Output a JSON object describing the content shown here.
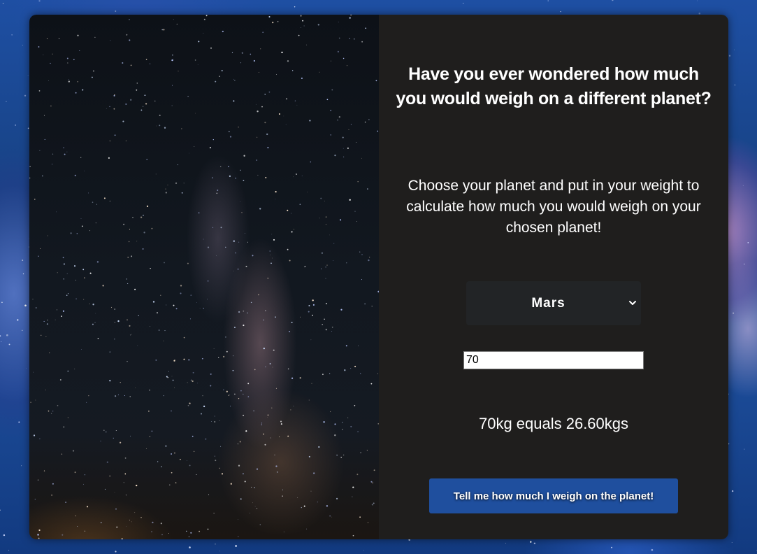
{
  "header": {
    "title": "Have you ever wondered how much you would weigh on a different planet?"
  },
  "description": "Choose your planet and put in your weight to calculate how much you would weigh on your chosen planet!",
  "planet_select": {
    "selected": "Mars"
  },
  "weight_input": {
    "value": "70"
  },
  "result": {
    "text": "70kg equals 26.60kgs"
  },
  "calculate_button": {
    "label": "Tell me how much I weigh on the planet!"
  },
  "colors": {
    "panel_background": "#1f1e1d",
    "button_background": "#1f4f9e",
    "select_background": "#222426",
    "page_background": "#1b4a96"
  },
  "icons": {
    "select_chevron": "chevron-down-icon"
  }
}
